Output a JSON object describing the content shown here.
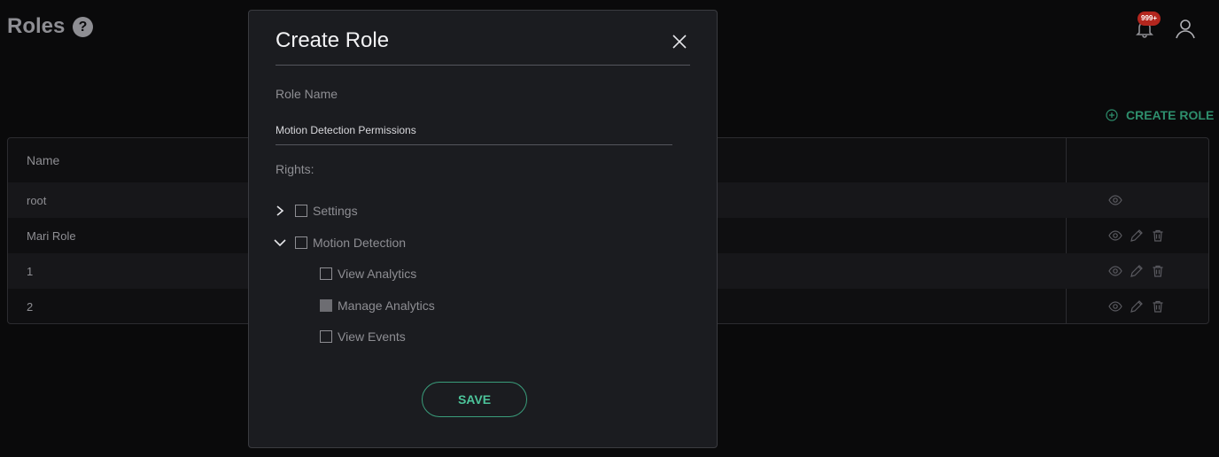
{
  "header": {
    "title": "Roles",
    "help_glyph": "?",
    "notifications_badge": "999+",
    "icons": [
      "help-icon",
      "bell-icon",
      "user-icon"
    ]
  },
  "create_role_link": "CREATE ROLE",
  "table": {
    "columns": [
      "Name"
    ],
    "rows": [
      {
        "name": "root",
        "actions": [
          "view"
        ]
      },
      {
        "name": "Mari Role",
        "actions": [
          "view",
          "edit",
          "delete"
        ]
      },
      {
        "name": "1",
        "actions": [
          "view",
          "edit",
          "delete"
        ]
      },
      {
        "name": "2",
        "actions": [
          "view",
          "edit",
          "delete"
        ]
      }
    ]
  },
  "modal": {
    "title": "Create Role",
    "role_name_label": "Role Name",
    "role_name_value": "Motion Detection Permissions",
    "rights_label": "Rights:",
    "rights": [
      {
        "label": "Settings",
        "expanded": false,
        "checked": false,
        "children": []
      },
      {
        "label": "Motion Detection",
        "expanded": true,
        "checked": false,
        "children": [
          {
            "label": "View Analytics",
            "checked": false
          },
          {
            "label": "Manage Analytics",
            "checked": true
          },
          {
            "label": "View Events",
            "checked": false
          }
        ]
      }
    ],
    "save_label": "SAVE"
  },
  "colors": {
    "accent": "#3a9d7b",
    "background": "#0a0a0b",
    "modal_background": "#1b1c20",
    "badge": "#b3261e"
  }
}
